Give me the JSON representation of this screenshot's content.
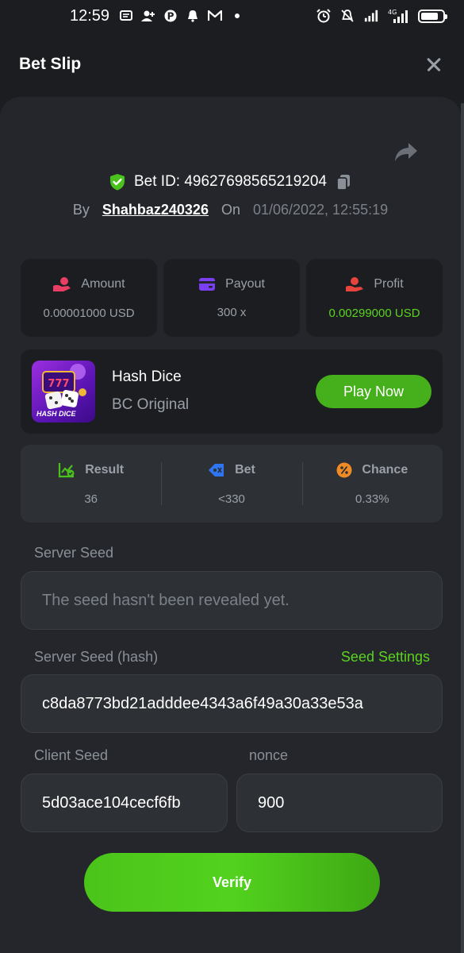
{
  "status_bar": {
    "time": "12:59",
    "network": "4G",
    "left_icons": [
      "message-icon",
      "contact-add-icon",
      "pinterest-icon",
      "bell-icon",
      "gmail-icon",
      "dot-icon"
    ],
    "right_icons": [
      "alarm-icon",
      "mute-icon",
      "signal-icon",
      "signal-4g-icon",
      "battery-icon"
    ]
  },
  "header": {
    "title": "Bet Slip"
  },
  "bet": {
    "id_label": "Bet ID: 49627698565219204",
    "by_label": "By",
    "user": "Shahbaz240326",
    "on_label": "On",
    "date": "01/06/2022, 12:55:19"
  },
  "stats": [
    {
      "label": "Amount",
      "value": "0.00001000 USD",
      "icon": "amount-icon"
    },
    {
      "label": "Payout",
      "value": "300 x",
      "icon": "wallet-icon"
    },
    {
      "label": "Profit",
      "value": "0.00299000 USD",
      "icon": "profit-icon"
    }
  ],
  "game": {
    "name": "Hash Dice",
    "subtitle": "BC Original",
    "thumb_label": "HASH DICE",
    "play_label": "Play Now"
  },
  "results": [
    {
      "label": "Result",
      "value": "36",
      "icon": "chart-check-icon"
    },
    {
      "label": "Bet",
      "value": "<330",
      "icon": "tag-icon"
    },
    {
      "label": "Chance",
      "value": "0.33%",
      "icon": "percent-icon"
    }
  ],
  "seeds": {
    "server_seed_label": "Server Seed",
    "server_seed_placeholder": "The seed hasn't been revealed yet.",
    "server_seed_hash_label": "Server Seed (hash)",
    "seed_settings_label": "Seed Settings",
    "server_seed_hash": "c8da8773bd21adddee4343a6f49a30a33e53a",
    "client_seed_label": "Client Seed",
    "client_seed": "5d03ace104cecf6fb",
    "nonce_label": "nonce",
    "nonce": "900"
  },
  "verify_label": "Verify",
  "colors": {
    "accent_green": "#5ad31f",
    "panel": "#24262b",
    "background": "#1b1d20"
  }
}
